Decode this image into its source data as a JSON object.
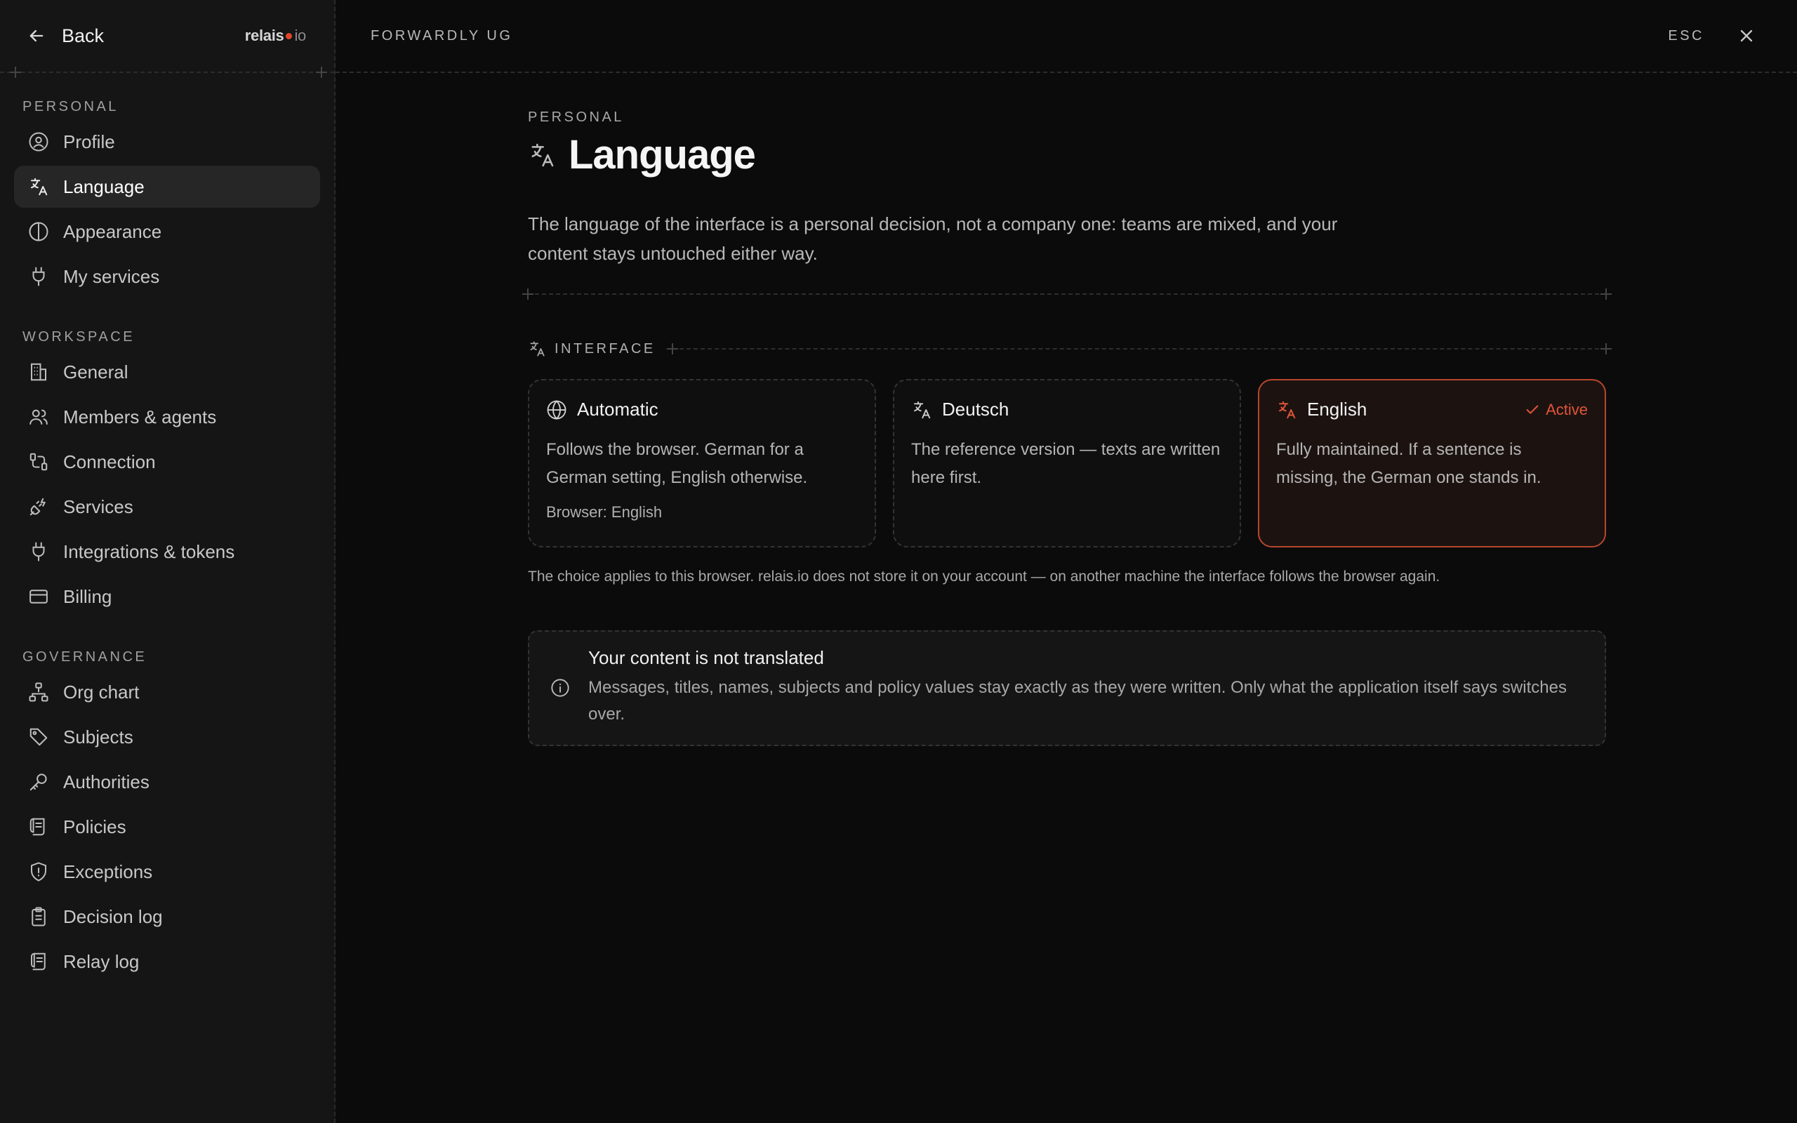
{
  "sidebar": {
    "back_label": "Back",
    "brand": {
      "name": "relais",
      "tld": "io"
    },
    "sections": [
      {
        "label": "PERSONAL",
        "items": [
          {
            "label": "Profile",
            "icon": "user-circle-icon"
          },
          {
            "label": "Language",
            "icon": "translate-icon",
            "active": true
          },
          {
            "label": "Appearance",
            "icon": "half-circle-icon"
          },
          {
            "label": "My services",
            "icon": "plug-icon"
          }
        ]
      },
      {
        "label": "WORKSPACE",
        "items": [
          {
            "label": "General",
            "icon": "building-icon"
          },
          {
            "label": "Members & agents",
            "icon": "users-icon"
          },
          {
            "label": "Connection",
            "icon": "route-icon"
          },
          {
            "label": "Services",
            "icon": "plug-zap-icon"
          },
          {
            "label": "Integrations & tokens",
            "icon": "plug-icon"
          },
          {
            "label": "Billing",
            "icon": "credit-card-icon"
          }
        ]
      },
      {
        "label": "GOVERNANCE",
        "items": [
          {
            "label": "Org chart",
            "icon": "org-chart-icon"
          },
          {
            "label": "Subjects",
            "icon": "tag-icon"
          },
          {
            "label": "Authorities",
            "icon": "key-icon"
          },
          {
            "label": "Policies",
            "icon": "scroll-icon"
          },
          {
            "label": "Exceptions",
            "icon": "shield-alert-icon"
          },
          {
            "label": "Decision log",
            "icon": "clipboard-icon"
          },
          {
            "label": "Relay log",
            "icon": "scroll-log-icon"
          }
        ]
      }
    ]
  },
  "topbar": {
    "breadcrumb": "FORWARDLY UG",
    "esc_label": "ESC"
  },
  "page": {
    "eyebrow": "PERSONAL",
    "title": "Language",
    "lead": "The language of the interface is a personal decision, not a company one: teams are mixed, and your content stays untouched either way."
  },
  "interface": {
    "section_label": "INTERFACE",
    "options": [
      {
        "title": "Automatic",
        "icon": "globe-icon",
        "body": "Follows the browser. German for a German setting, English otherwise.",
        "meta": "Browser: English",
        "active": false
      },
      {
        "title": "Deutsch",
        "icon": "translate-icon",
        "body": "The reference version — texts are written here first.",
        "meta": "",
        "active": false
      },
      {
        "title": "English",
        "icon": "translate-icon",
        "body": "Fully maintained. If a sentence is missing, the German one stands in.",
        "meta": "",
        "active": true,
        "badge": "Active"
      }
    ],
    "note": "The choice applies to this browser. relais.io does not store it on your account — on another machine the interface follows the browser again."
  },
  "info": {
    "title": "Your content is not translated",
    "text": "Messages, titles, names, subjects and policy values stay exactly as they were written. Only what the application itself says switches over."
  },
  "colors": {
    "accent": "#e0553a",
    "active_border": "#b5472c",
    "sidebar_bg": "#151515",
    "main_bg": "#0b0b0b"
  }
}
